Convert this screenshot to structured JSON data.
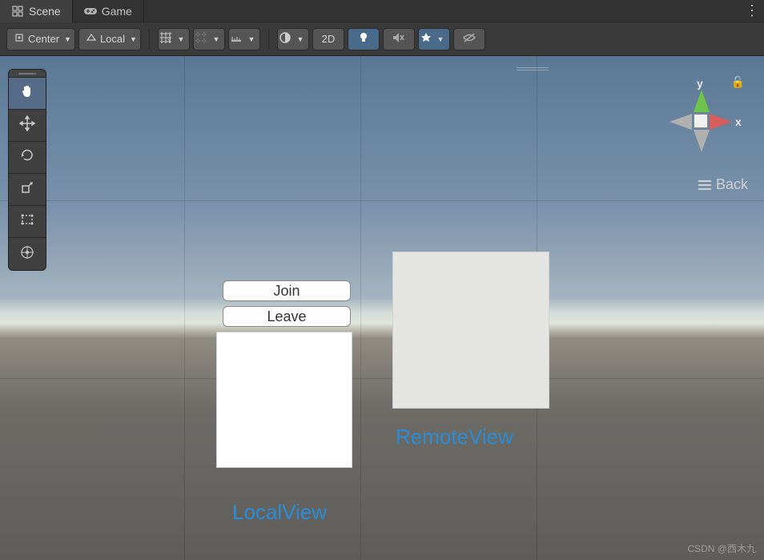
{
  "tabs": {
    "scene": "Scene",
    "game": "Game"
  },
  "toolbar": {
    "handle_position": "Center",
    "handle_rotation": "Local",
    "mode_2d": "2D"
  },
  "gizmo": {
    "x_axis": "x",
    "y_axis": "y",
    "back": "Back"
  },
  "scene_ui": {
    "join_button": "Join",
    "leave_button": "Leave",
    "local_view_label": "LocalView",
    "remote_view_label": "RemoteView"
  },
  "watermark": "CSDN @西木九"
}
